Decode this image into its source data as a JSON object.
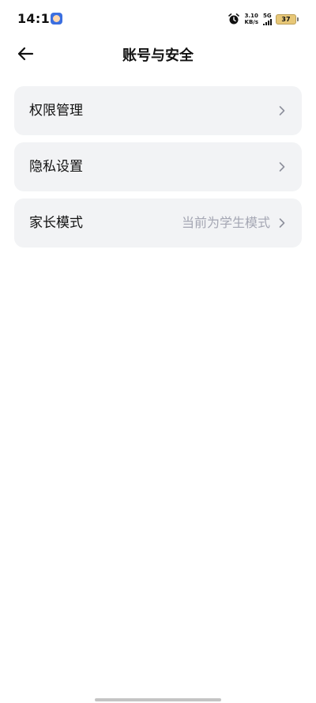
{
  "status_bar": {
    "time": "14:18",
    "net_speed_value": "3.10",
    "net_speed_unit": "KB/s",
    "network_type": "5G",
    "battery_level": "37"
  },
  "header": {
    "title": "账号与安全"
  },
  "menu": {
    "items": [
      {
        "label": "权限管理",
        "value": ""
      },
      {
        "label": "隐私设置",
        "value": ""
      },
      {
        "label": "家长模式",
        "value": "当前为学生模式"
      }
    ]
  },
  "icons": {
    "back": "arrow-left-icon",
    "chevron": "chevron-right-icon",
    "alarm": "alarm-clock-icon"
  },
  "colors": {
    "card_background": "#f2f3f5",
    "secondary_text": "#a4a6b3",
    "battery": "#e7c777"
  }
}
